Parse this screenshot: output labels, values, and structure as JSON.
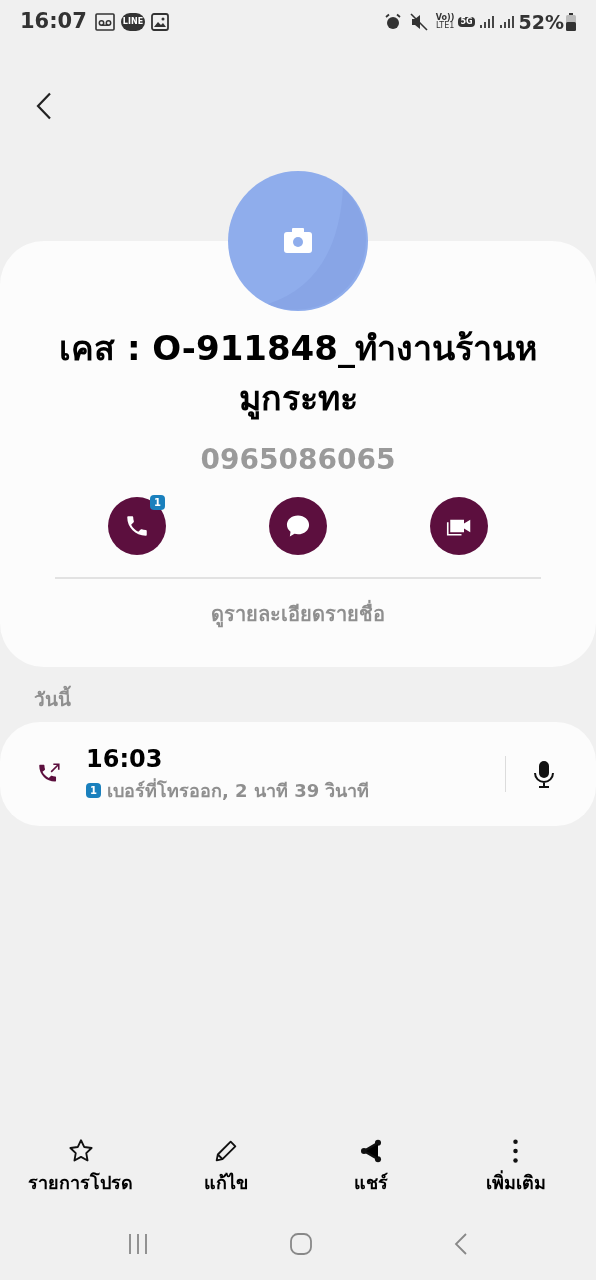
{
  "status_bar": {
    "time": "16:07",
    "line_label": "LINE",
    "volte": "Vo))",
    "lte": "LTE1",
    "network": "5G",
    "battery": "52%"
  },
  "contact": {
    "name": "เคส : O-911848_ทำงานร้านหมูกระทะ",
    "phone": "0965086065"
  },
  "actions": [
    {
      "kind": "call",
      "badge": "1"
    },
    {
      "kind": "message"
    },
    {
      "kind": "video"
    }
  ],
  "details_link": "ดูรายละเอียดรายชื่อ",
  "section_title": "วันนี้",
  "calls": [
    {
      "time": "16:03",
      "sim": "1",
      "description": "เบอร์ที่โทรออก, 2 นาที 39 วินาที"
    }
  ],
  "bottom_bar": [
    {
      "kind": "star",
      "label": "รายการโปรด"
    },
    {
      "kind": "edit",
      "label": "แก้ไข"
    },
    {
      "kind": "share",
      "label": "แชร์"
    },
    {
      "kind": "more",
      "label": "เพิ่มเติม"
    }
  ]
}
